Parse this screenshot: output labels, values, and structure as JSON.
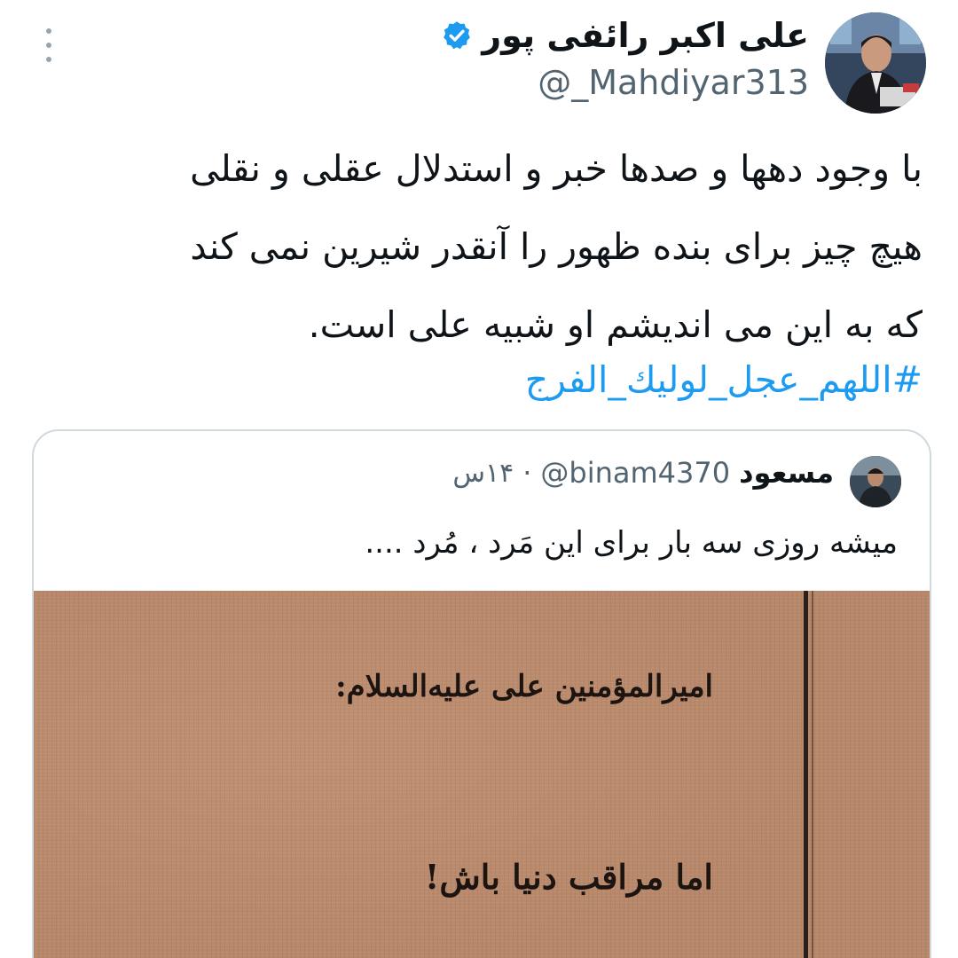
{
  "author": {
    "name": "علی اکبر رائفی پور",
    "handle": "@_Mahdiyar313",
    "verified": true
  },
  "tweet": {
    "lines": [
      "با وجود دهها و صدها خبر و استدلال عقلی و نقلی",
      "هیچ چیز برای بنده ظهور را آنقدر شیرین نمی کند",
      "که  به این می اندیشم او شبیه علی است."
    ],
    "hashtag": "#اللهم_عجل_لوليك_الفرج"
  },
  "quoted_tweet": {
    "author_name": "مسعود",
    "handle": "@binam4370",
    "separator": "·",
    "time": "۱۴س",
    "text": "میشه روزی سه بار برای این مَرد ، مُرد ....",
    "media": {
      "line1": "امیرالمؤمنین علی علیه‌السلام:",
      "line2": "اما مراقب دنیا باش!"
    }
  },
  "colors": {
    "link": "#1d9bf0",
    "verified": "#1d9bf0",
    "muted_text": "#536471",
    "media_background": "#b7876a"
  },
  "icons": {
    "more": "more-vertical-icon",
    "verified": "verified-badge-icon"
  }
}
